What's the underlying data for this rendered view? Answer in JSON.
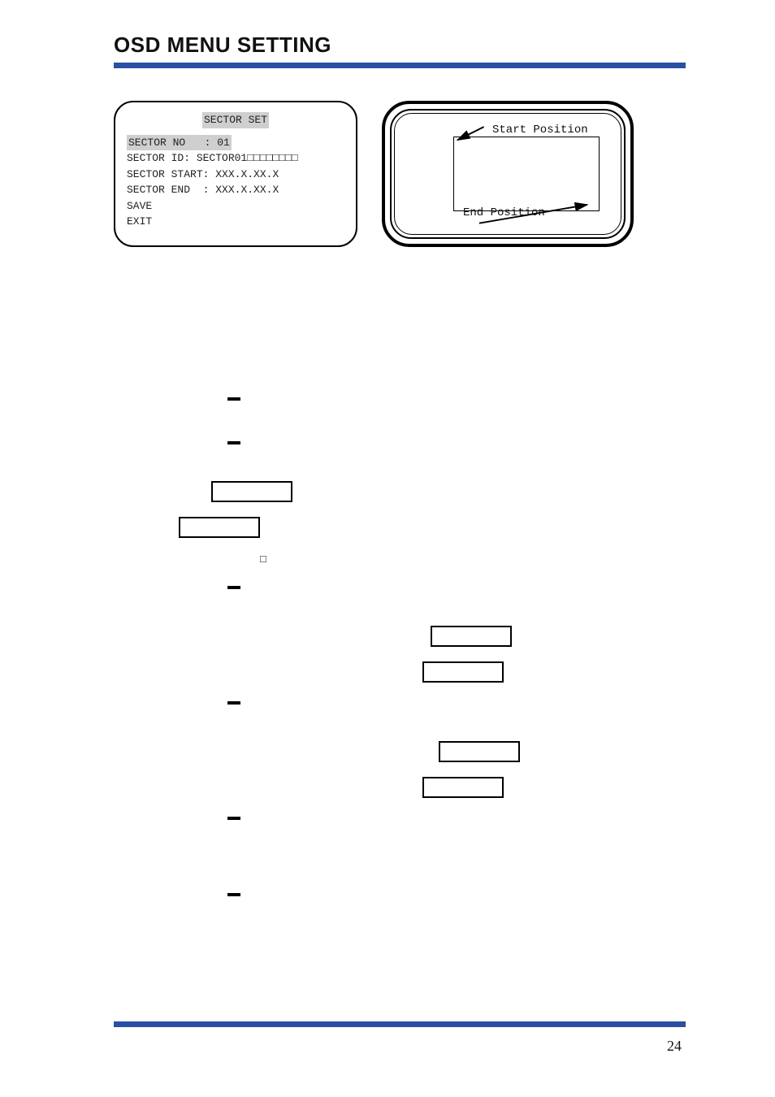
{
  "page_title": "OSD MENU SETTING",
  "page_number": "24",
  "panel": {
    "heading": "SECTOR SET",
    "rows": {
      "sector_no_label": "SECTOR NO",
      "sector_no_value": "01",
      "sector_id_label": "SECTOR ID:",
      "sector_id_value": "SECTOR01□□□□□□□□",
      "sector_start_label": "SECTOR START:",
      "sector_start_value": "XXX.X.XX.X",
      "sector_end_label": "SECTOR END  :",
      "sector_end_value": "XXX.X.XX.X",
      "save": "SAVE",
      "exit": "EXIT"
    }
  },
  "screen": {
    "start_label": "Start Position",
    "end_label": "End Position"
  }
}
